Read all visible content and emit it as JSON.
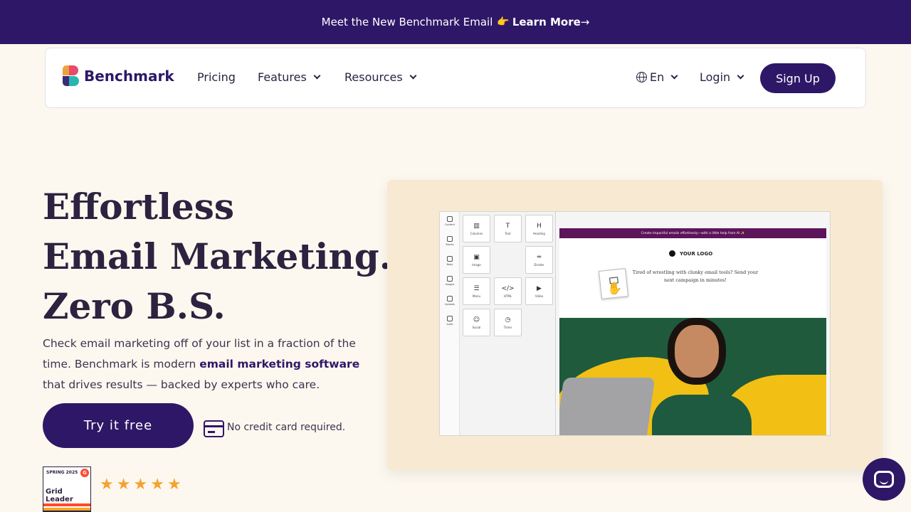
{
  "announcement": {
    "text": "Meet the New Benchmark Email",
    "emoji": "👉",
    "cta": "Learn More",
    "arrow": "→"
  },
  "nav": {
    "brand": "Benchmark",
    "links": [
      {
        "label": "Pricing"
      },
      {
        "label": "Features"
      },
      {
        "label": "Resources"
      }
    ],
    "language": "En",
    "login": "Login",
    "signup": "Sign Up"
  },
  "hero": {
    "title_lines": [
      "Effortless",
      "Email Marketing.",
      "Zero B.S."
    ],
    "description_before": "Check email marketing off of your list in a fraction of the time. Benchmark is modern ",
    "description_link": "email marketing software",
    "description_after": " that drives results — backed by experts who care.",
    "cta": "Try it free",
    "no_credit_card": "No credit card required."
  },
  "badge": {
    "season": "SPRING 2025",
    "g2": "G",
    "title": "Grid Leader"
  },
  "rating": {
    "stars": 5,
    "max": 5
  },
  "editor": {
    "rail": [
      "Content",
      "Blocks",
      "Body",
      "Images",
      "Uploads",
      "Audit"
    ],
    "blocks": [
      {
        "icon": "▥",
        "label": "Columns"
      },
      {
        "icon": "T",
        "label": "Text"
      },
      {
        "icon": "H",
        "label": "Heading"
      },
      {
        "icon": "▣",
        "label": "Image"
      },
      {
        "icon": "═",
        "label": "Divider"
      },
      {
        "icon": "☰",
        "label": "Menu"
      },
      {
        "icon": "</>",
        "label": "HTML"
      },
      {
        "icon": "▶",
        "label": "Video"
      },
      {
        "icon": "☺",
        "label": "Social"
      },
      {
        "icon": "◷",
        "label": "Timer"
      }
    ],
    "preheader": "Create impactful emails effortlessly—with a little help from AI ✨",
    "logo_text": "YOUR LOGO",
    "email_copy": "Tired of wrestling with clunky email tools? Send your next campaign in minutes!"
  },
  "colors": {
    "brand": "#2e1767",
    "background": "#fdf8ef",
    "star": "#f5a230",
    "showcase": "#f8ead2"
  }
}
